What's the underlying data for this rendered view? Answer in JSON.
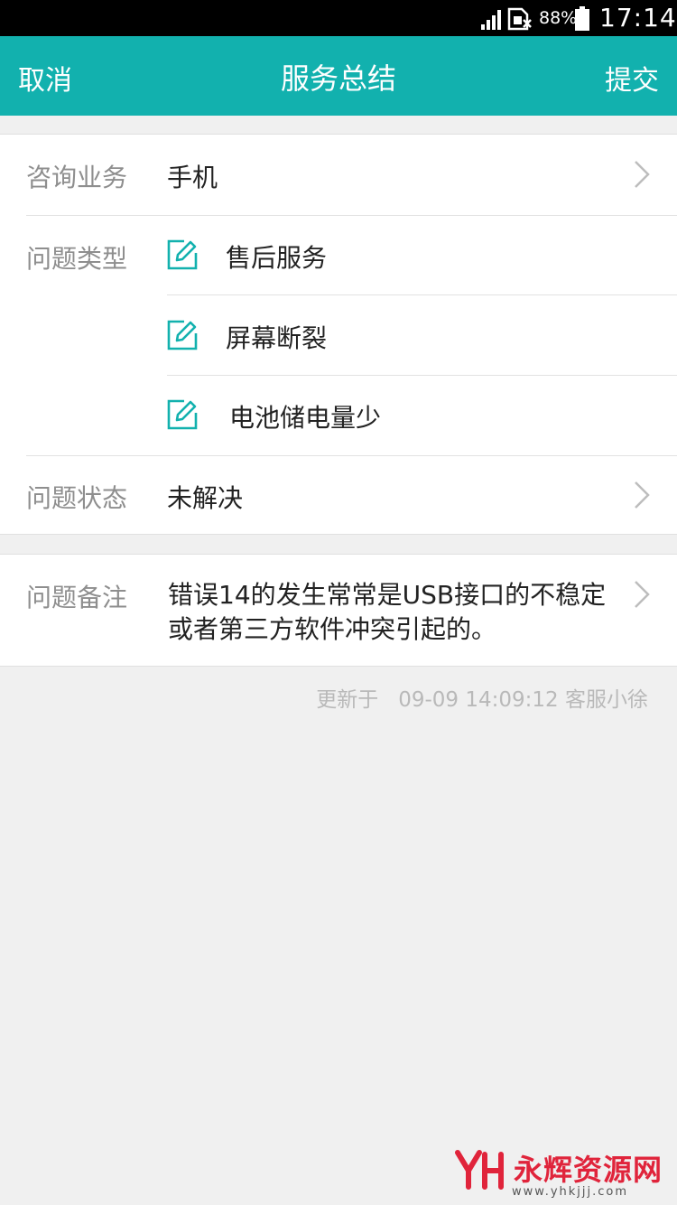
{
  "status_bar": {
    "battery_percent": "88%",
    "time": "17:14"
  },
  "nav": {
    "cancel": "取消",
    "title": "服务总结",
    "submit": "提交"
  },
  "form": {
    "business": {
      "label": "咨询业务",
      "value": "手机"
    },
    "problem_type": {
      "label": "问题类型",
      "items": [
        "售后服务",
        "屏幕断裂",
        "电池储电量少"
      ]
    },
    "problem_status": {
      "label": "问题状态",
      "value": "未解决"
    },
    "note": {
      "label": "问题备注",
      "value": "错误14的发生常常是USB接口的不稳定或者第三方软件冲突引起的。"
    }
  },
  "update_info": {
    "prefix": "更新于",
    "datetime": "09-09 14:09:12",
    "agent": "客服小徐"
  },
  "watermark": {
    "title": "永辉资源网",
    "url": "www.yhkjjj.com"
  },
  "colors": {
    "accent": "#12b1ae",
    "watermark": "#e0243b"
  },
  "icons": [
    "signal-icon",
    "sim-icon",
    "battery-icon",
    "chevron-right-icon",
    "edit-icon"
  ]
}
